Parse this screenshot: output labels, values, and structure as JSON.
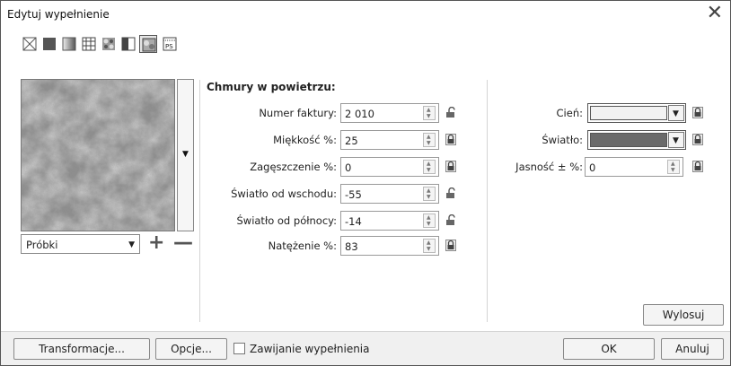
{
  "window": {
    "title": "Edytuj wypełnienie",
    "close_icon": "close-icon"
  },
  "toolbar": {
    "fill_types": [
      {
        "name": "no-fill",
        "icon": "no-fill-icon"
      },
      {
        "name": "uniform",
        "icon": "uniform-fill-icon"
      },
      {
        "name": "fountain",
        "icon": "fountain-fill-icon"
      },
      {
        "name": "vector-pattern",
        "icon": "vector-pattern-icon"
      },
      {
        "name": "bitmap-pattern",
        "icon": "bitmap-pattern-icon"
      },
      {
        "name": "two-color",
        "icon": "two-color-pattern-icon"
      },
      {
        "name": "texture",
        "icon": "texture-fill-icon",
        "active": true
      },
      {
        "name": "postscript",
        "icon": "postscript-fill-icon",
        "text": "PS"
      }
    ]
  },
  "library": {
    "select_value": "Próbki",
    "add_icon": "plus-icon",
    "remove_icon": "minus-icon"
  },
  "texture": {
    "section_title": "Chmury w powietrzu:",
    "fields": [
      {
        "label": "Numer faktury:",
        "value": "2 010",
        "locked": false
      },
      {
        "label": "Miękkość %:",
        "value": "25",
        "locked": true
      },
      {
        "label": "Zagęszczenie %:",
        "value": "0",
        "locked": true
      },
      {
        "label": "Światło od wschodu:",
        "value": "-55",
        "locked": false
      },
      {
        "label": "Światło od północy:",
        "value": "-14",
        "locked": false
      },
      {
        "label": "Natężenie %:",
        "value": "83",
        "locked": true
      }
    ]
  },
  "colors": {
    "shadow_label": "Cień:",
    "shadow_color": "#f2f2f2",
    "light_label": "Światło:",
    "light_color": "#6a6a6a",
    "brightness_label": "Jasność ± %:",
    "brightness_value": "0",
    "randomize_label": "Wylosuj"
  },
  "footer": {
    "transform_label": "Transformacje...",
    "options_label": "Opcje...",
    "wrap_fill_label": "Zawijanie wypełnienia",
    "wrap_fill_checked": false,
    "ok_label": "OK",
    "cancel_label": "Anuluj"
  }
}
